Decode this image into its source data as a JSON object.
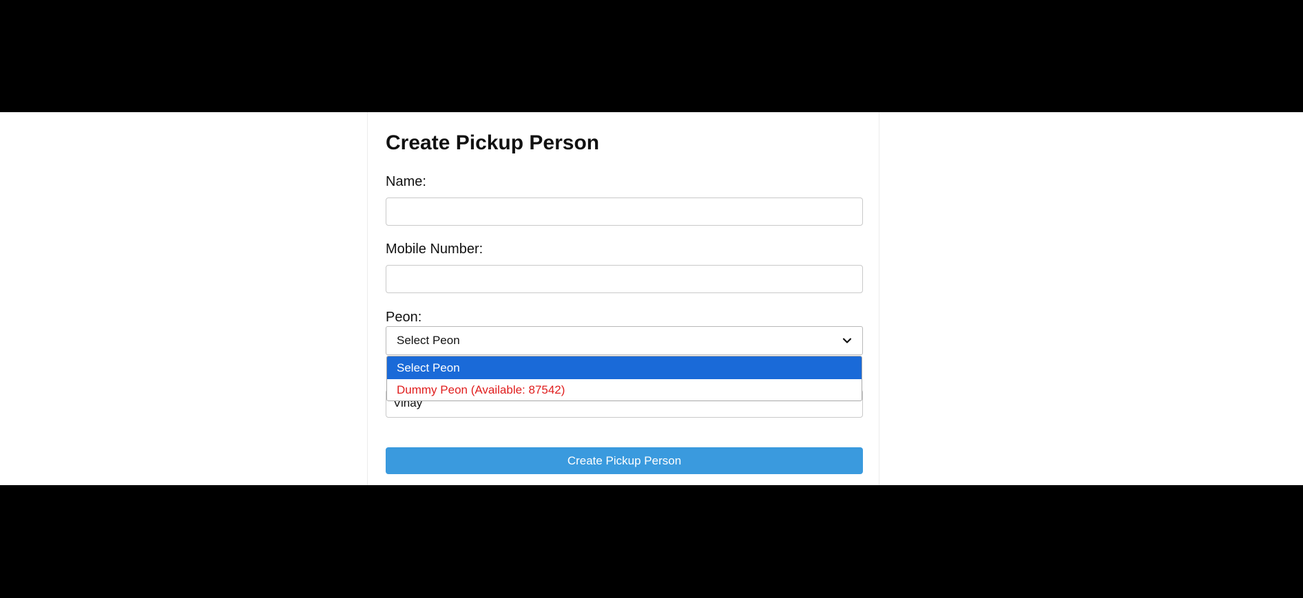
{
  "form": {
    "title": "Create Pickup Person",
    "name_label": "Name:",
    "name_value": "",
    "mobile_label": "Mobile Number:",
    "mobile_value": "",
    "peon_label": "Peon:",
    "peon_selected": "Select Peon",
    "peon_options": [
      {
        "label": "Select Peon",
        "highlighted": true
      },
      {
        "label": "Dummy Peon (Available: 87542)",
        "color": "#e01e1e"
      }
    ],
    "hidden_field_value": "Vinay",
    "submit_label": "Create Pickup Person"
  },
  "icons": {
    "select_arrow": "chevron-down-icon"
  },
  "colors": {
    "highlight": "#1a6ad8",
    "button": "#3a9ade",
    "warning_text": "#e01e1e",
    "letterbox": "#000000"
  }
}
